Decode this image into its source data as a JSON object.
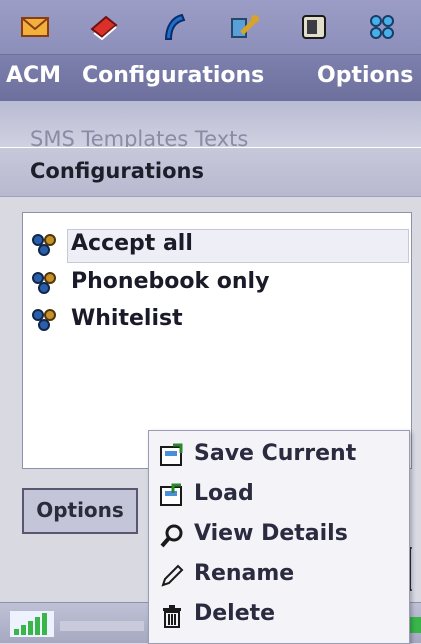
{
  "toolbar": {
    "icons": [
      "envelope-icon",
      "book-icon",
      "phone-icon",
      "tools-icon",
      "device-icon",
      "grid-icon"
    ]
  },
  "menubar": {
    "items": [
      "ACM",
      "Configurations",
      "Options"
    ]
  },
  "background": {
    "partial_text": "SMS Templates Texts"
  },
  "dialog": {
    "title": "Configurations",
    "list": [
      {
        "label": "Accept all",
        "selected": true,
        "icon": "config-icon"
      },
      {
        "label": "Phonebook only",
        "selected": false,
        "icon": "config-icon"
      },
      {
        "label": "Whitelist",
        "selected": false,
        "icon": "config-icon"
      }
    ],
    "options_button": "Options"
  },
  "popup_menu": {
    "items": [
      {
        "label": "Save Current",
        "icon": "save-icon"
      },
      {
        "label": "Load",
        "icon": "load-icon"
      },
      {
        "label": "View Details",
        "icon": "magnifier-icon"
      },
      {
        "label": "Rename",
        "icon": "pencil-icon"
      },
      {
        "label": "Delete",
        "icon": "trash-icon"
      }
    ]
  },
  "colors": {
    "toolbar": "#9b9dc6",
    "menubar": "#6d709d",
    "dialog_bg": "#d9d9e2",
    "signal_green": "#39b54a"
  }
}
